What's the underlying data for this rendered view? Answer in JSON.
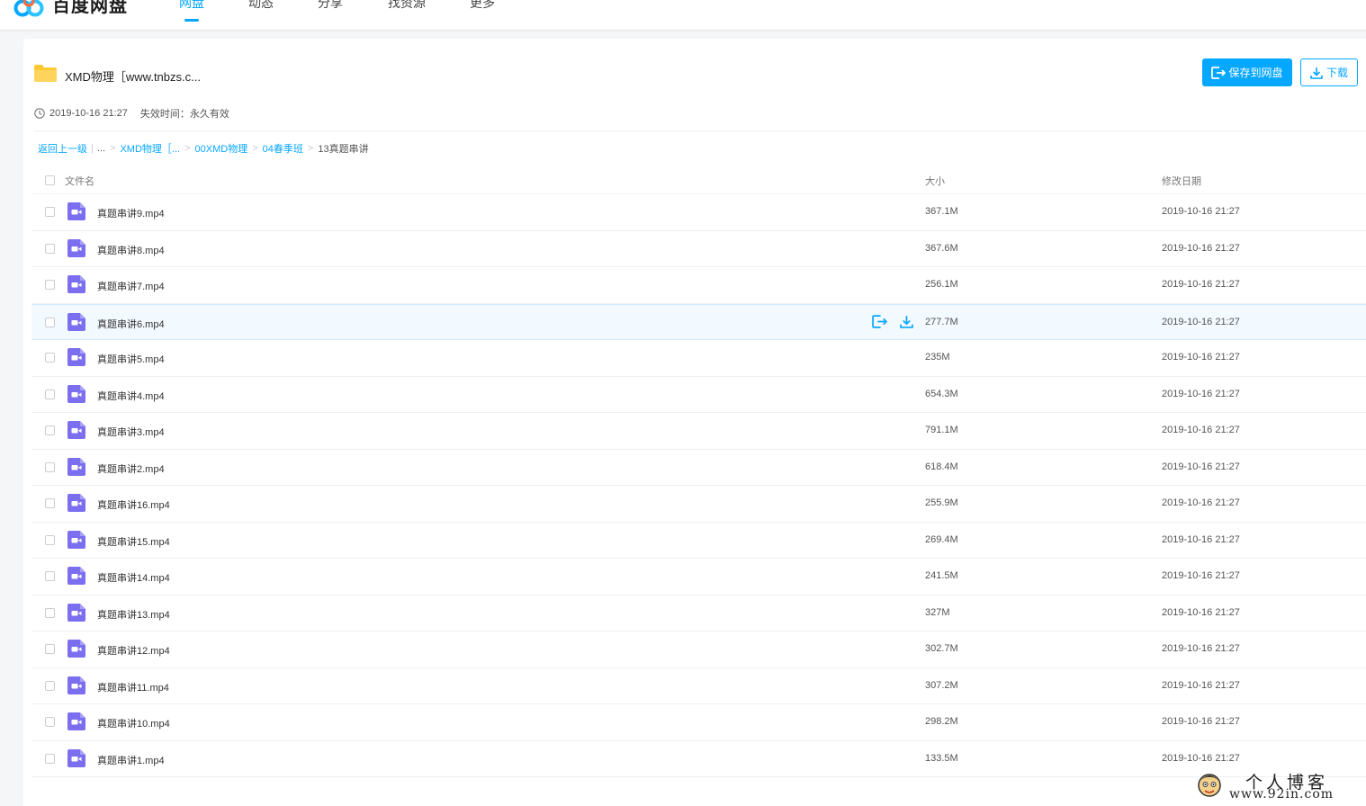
{
  "app": {
    "logo_text": "百度网盘",
    "nav": [
      {
        "label": "网盘",
        "active": true
      },
      {
        "label": "动态",
        "active": false
      },
      {
        "label": "分享",
        "active": false
      },
      {
        "label": "找资源",
        "active": false
      },
      {
        "label": "更多",
        "active": false
      }
    ]
  },
  "share": {
    "title": "XMD物理［www.tnbzs.c...",
    "created": "2019-10-16 21:27",
    "expiry_label": "失效时间：",
    "expiry_value": "永久有效",
    "save_label": "保存到网盘",
    "download_label": "下载"
  },
  "breadcrumb": {
    "back": "返回上一级",
    "ellipsis": "...",
    "items": [
      "XMD物理［...",
      "00XMD物理",
      "04春季班"
    ],
    "current": "13真题串讲"
  },
  "table": {
    "headers": {
      "name": "文件名",
      "size": "大小",
      "date": "修改日期"
    },
    "rows": [
      {
        "name": "真题串讲9.mp4",
        "size": "367.1M",
        "date": "2019-10-16 21:27"
      },
      {
        "name": "真题串讲8.mp4",
        "size": "367.6M",
        "date": "2019-10-16 21:27"
      },
      {
        "name": "真题串讲7.mp4",
        "size": "256.1M",
        "date": "2019-10-16 21:27"
      },
      {
        "name": "真题串讲6.mp4",
        "size": "277.7M",
        "date": "2019-10-16 21:27"
      },
      {
        "name": "真题串讲5.mp4",
        "size": "235M",
        "date": "2019-10-16 21:27"
      },
      {
        "name": "真题串讲4.mp4",
        "size": "654.3M",
        "date": "2019-10-16 21:27"
      },
      {
        "name": "真题串讲3.mp4",
        "size": "791.1M",
        "date": "2019-10-16 21:27"
      },
      {
        "name": "真题串讲2.mp4",
        "size": "618.4M",
        "date": "2019-10-16 21:27"
      },
      {
        "name": "真题串讲16.mp4",
        "size": "255.9M",
        "date": "2019-10-16 21:27"
      },
      {
        "name": "真题串讲15.mp4",
        "size": "269.4M",
        "date": "2019-10-16 21:27"
      },
      {
        "name": "真题串讲14.mp4",
        "size": "241.5M",
        "date": "2019-10-16 21:27"
      },
      {
        "name": "真题串讲13.mp4",
        "size": "327M",
        "date": "2019-10-16 21:27"
      },
      {
        "name": "真题串讲12.mp4",
        "size": "302.7M",
        "date": "2019-10-16 21:27"
      },
      {
        "name": "真题串讲11.mp4",
        "size": "307.2M",
        "date": "2019-10-16 21:27"
      },
      {
        "name": "真题串讲10.mp4",
        "size": "298.2M",
        "date": "2019-10-16 21:27"
      },
      {
        "name": "真题串讲1.mp4",
        "size": "133.5M",
        "date": "2019-10-16 21:27"
      }
    ],
    "hover_row": 3
  },
  "watermark": {
    "line1": "个人博客",
    "line2": "www.92in.com"
  },
  "colors": {
    "accent": "#06a7ff",
    "video_icon": "#7b6ff0",
    "folder": "#ffc933",
    "hover_row_bg": "#f2f9ff"
  },
  "icons": {
    "logo": "baidu-cloud-logo-icon",
    "folder": "folder-icon",
    "clock": "clock-icon",
    "save": "save-to-disk-icon",
    "download": "download-icon",
    "video_file": "video-file-icon"
  }
}
